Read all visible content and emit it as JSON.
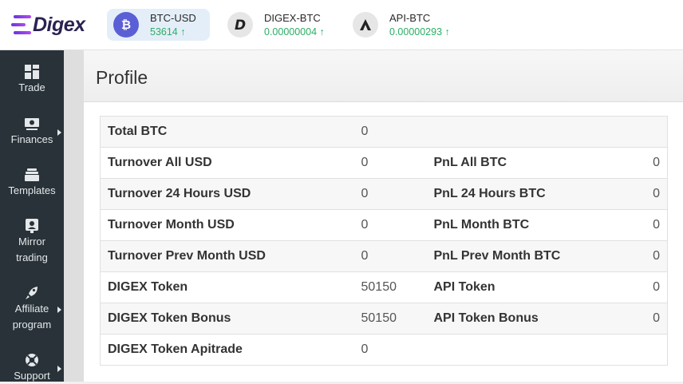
{
  "brand": {
    "name": "Digex"
  },
  "tickers": [
    {
      "pair": "BTC-USD",
      "price": "53614 ↑",
      "icon": "bitcoin-icon"
    },
    {
      "pair": "DIGEX-BTC",
      "price": "0.00000004 ↑",
      "icon": "digex-coin-icon"
    },
    {
      "pair": "API-BTC",
      "price": "0.00000293 ↑",
      "icon": "api-coin-icon"
    }
  ],
  "sidebar": {
    "items": [
      {
        "label": "Trade",
        "icon": "grid-icon"
      },
      {
        "label": "Finances",
        "icon": "money-icon"
      },
      {
        "label": "Templates",
        "icon": "stack-icon"
      },
      {
        "label": "Mirror trading",
        "icon": "mirror-icon"
      },
      {
        "label": "Affiliate program",
        "icon": "rocket-icon"
      },
      {
        "label": "Support",
        "icon": "lifebuoy-icon"
      }
    ]
  },
  "page": {
    "title": "Profile"
  },
  "profile": {
    "rows": [
      {
        "label": "Total BTC",
        "value": "0",
        "label2": "",
        "value2": ""
      },
      {
        "label": "Turnover All USD",
        "value": "0",
        "label2": "PnL All BTC",
        "value2": "0"
      },
      {
        "label": "Turnover 24 Hours USD",
        "value": "0",
        "label2": "PnL 24 Hours BTC",
        "value2": "0"
      },
      {
        "label": "Turnover Month USD",
        "value": "0",
        "label2": "PnL Month BTC",
        "value2": "0"
      },
      {
        "label": "Turnover Prev Month USD",
        "value": "0",
        "label2": "PnL Prev Month BTC",
        "value2": "0"
      },
      {
        "label": "DIGEX Token",
        "value": "50150",
        "label2": "API Token",
        "value2": "0"
      },
      {
        "label": "DIGEX Token Bonus",
        "value": "50150",
        "label2": "API Token Bonus",
        "value2": "0"
      },
      {
        "label": "DIGEX Token Apitrade",
        "value": "0",
        "label2": "",
        "value2": ""
      }
    ]
  },
  "colors": {
    "accent": "#5b5fd6",
    "up": "#2bae66",
    "sidebar": "#283238"
  }
}
